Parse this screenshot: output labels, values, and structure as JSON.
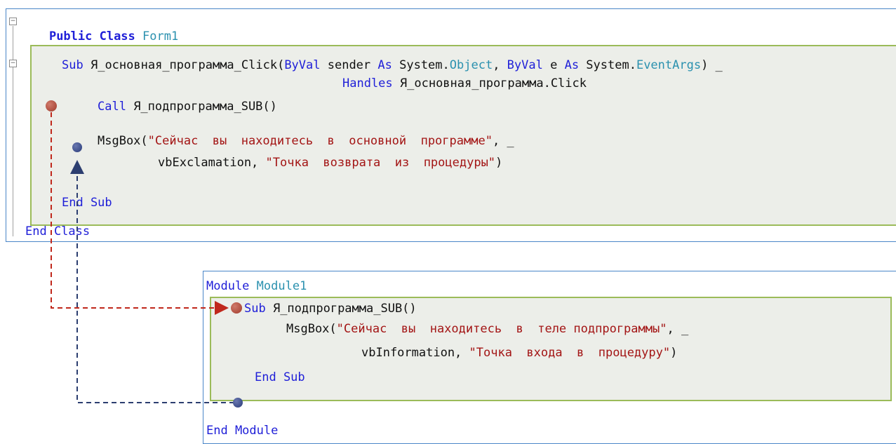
{
  "form_panel": {
    "line1": {
      "kw1": "Public Class",
      "name": "Form1"
    },
    "sub_block": {
      "decl": {
        "kw_sub": "Sub",
        "name": "Я_основная_программа_Click(",
        "byval1": "ByVal",
        "sender": " sender ",
        "as1": "As",
        "system1": " System.",
        "object": "Object",
        "comma": ", ",
        "byval2": "ByVal",
        "e": " e ",
        "as2": "As",
        "system2": " System.",
        "eventargs": "EventArgs",
        "cont": ") _"
      },
      "handles": {
        "kw": "Handles",
        "rest": " Я_основная_программа.Click"
      },
      "call": {
        "kw": "Call",
        "rest": " Я_подпрограмма_SUB()"
      },
      "msgbox1": {
        "fn": "MsgBox(",
        "str": "\"Сейчас  вы  находитесь  в  основной  программе\"",
        "tail": ", _"
      },
      "msgbox2": {
        "arg": "vbExclamation, ",
        "str": "\"Точка  возврата  из  процедуры\"",
        "tail": ")"
      },
      "end_sub": "End Sub"
    },
    "end_class": "End Class"
  },
  "module_panel": {
    "line1": {
      "kw": "Module",
      "name": "Module1"
    },
    "sub_block": {
      "decl": {
        "kw": "Sub",
        "rest": " Я_подпрограмма_SUB()"
      },
      "msgbox1": {
        "fn": "MsgBox(",
        "str": "\"Сейчас  вы  находитесь  в  теле подпрограммы\"",
        "tail": ", _"
      },
      "msgbox2": {
        "arg": "vbInformation, ",
        "str": "\"Точка  входа  в  процедуру\"",
        "tail": ")"
      },
      "end_sub": "End Sub"
    },
    "end_module": "End Module"
  },
  "colors": {
    "keyword": "#1f1fd8",
    "type": "#2b91af",
    "string": "#a31515",
    "call_arrow": "#c0281c",
    "return_arrow": "#2c3e70",
    "block_border": "#9bbb59",
    "panel_border": "#4a86c8"
  }
}
